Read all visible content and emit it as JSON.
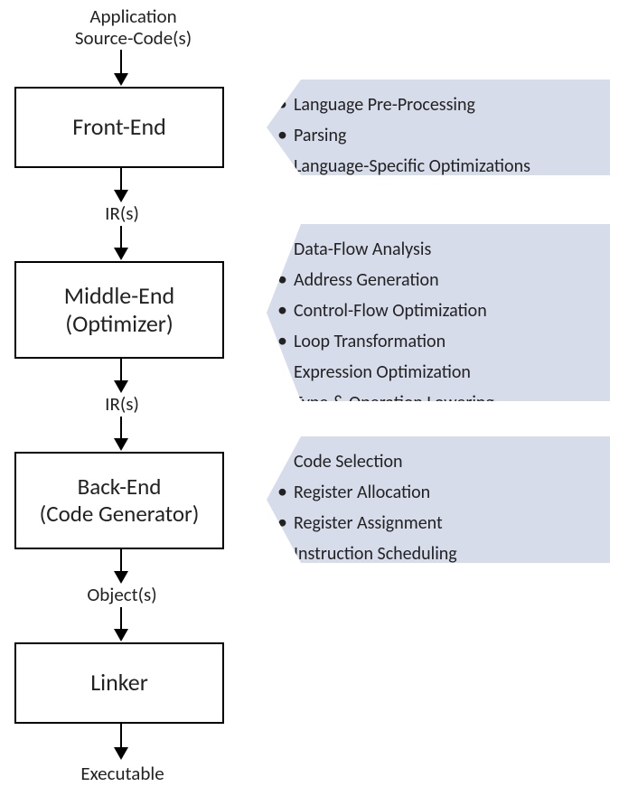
{
  "labels": {
    "source": "Application\nSource-Code(s)",
    "ir1": "IR(s)",
    "ir2": "IR(s)",
    "objects": "Object(s)",
    "exec": "Executable"
  },
  "stages": {
    "frontend": "Front-End",
    "middleend": "Middle-End\n(Optimizer)",
    "backend": "Back-End\n(Code Generator)",
    "linker": "Linker"
  },
  "callouts": {
    "frontend": [
      "Language Pre-Processing",
      "Parsing",
      "Language-Specific Optimizations"
    ],
    "middleend": [
      "Data-Flow Analysis",
      "Address Generation",
      "Control-Flow Optimization",
      "Loop Transformation",
      "Expression Optimization",
      "Type & Operation Lowering"
    ],
    "backend": [
      "Code Selection",
      "Register Allocation",
      "Register Assignment",
      "Instruction Scheduling"
    ]
  },
  "colors": {
    "callout_bg": "#d6dcea",
    "border": "#000000",
    "text": "#222222"
  }
}
